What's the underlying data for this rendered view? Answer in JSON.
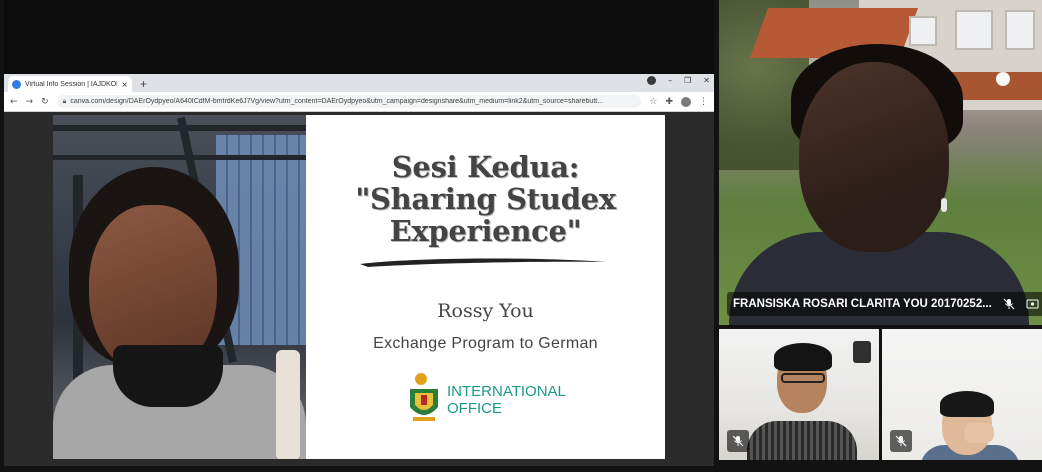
{
  "browser": {
    "tab_title": "Virtual Info Session | IAJDKOM - II",
    "tab_close": "×",
    "new_tab": "+",
    "url": "canva.com/design/DAErOydpyeo/A640ICdfM-bmtrdKe6J7Vg/view?utm_content=DAErOydpyeo&utm_campaign=designshare&utm_medium=link2&utm_source=sharebutt...",
    "window_controls": [
      "–",
      "❐",
      "✕"
    ],
    "nav": {
      "back": "←",
      "forward": "→",
      "reload": "↻"
    }
  },
  "slide": {
    "title_line1": "Sesi Kedua:",
    "title_line2": "\"Sharing Studex",
    "title_line3": "Experience\"",
    "presenter": "Rossy You",
    "program": "Exchange Program to German",
    "logo_line1": "INTERNATIONAL",
    "logo_line2": "OFFICE"
  },
  "participants": {
    "main": {
      "name": "FRANSISKA ROSARI CLARITA YOU 20170252..."
    }
  },
  "colors": {
    "logo_teal": "#1b9a8a",
    "slide_text": "#444444",
    "background": "#121212"
  },
  "icons": [
    "globe-icon",
    "lock-icon",
    "star-icon",
    "puzzle-icon",
    "menu-dots-icon",
    "mic-off-icon",
    "screen-share-icon"
  ]
}
